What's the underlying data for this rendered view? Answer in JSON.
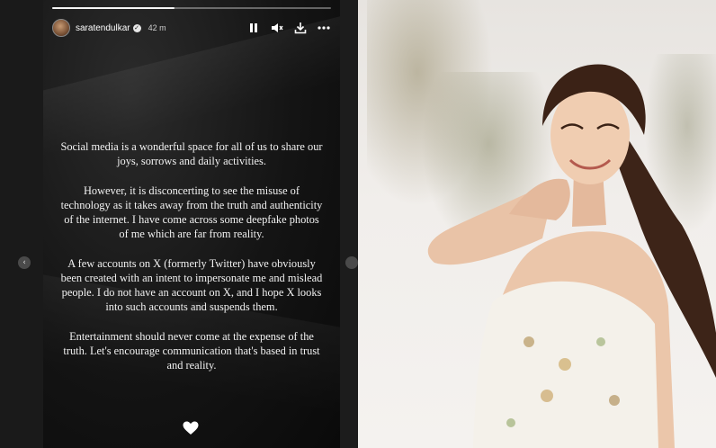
{
  "story": {
    "progress_fraction": 0.44,
    "username": "saratendulkar",
    "time_ago": "42 m",
    "controls": [
      "pause-icon",
      "mute-icon",
      "download-icon",
      "more-icon"
    ],
    "paragraphs": [
      "Social media is a wonderful space for all of us to share our joys, sorrows and daily activities.",
      "However, it is disconcerting to see the misuse of technology as it takes away from the truth and authenticity of the internet. I have come across some deepfake photos of me which are far from reality.",
      "A few accounts on X (formerly Twitter) have obviously been created with an intent to impersonate me and mislead people. I do not have an account on X, and I hope X looks into such accounts and suspends them.",
      "Entertainment should never come at the expense of the truth. Let's encourage communication that's based in trust and reality."
    ],
    "reaction": "heart-icon"
  },
  "colors": {
    "story_bg": "#141414",
    "text": "#f2f2f2",
    "photo_bg": "#f1eeeb"
  }
}
